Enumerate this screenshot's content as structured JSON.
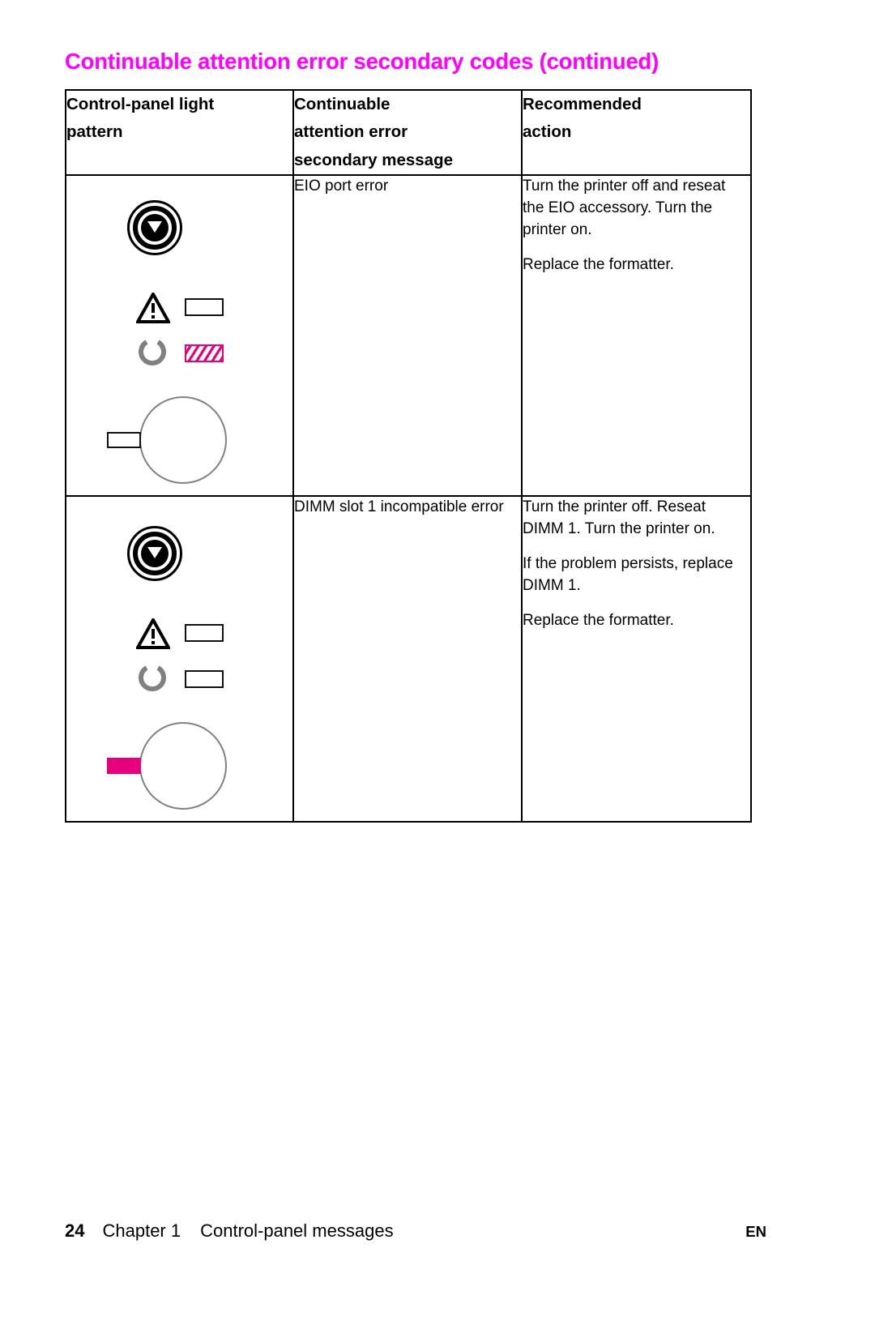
{
  "page": {
    "title": "Continuable attention error secondary codes (continued)",
    "title_color": "#ff00ff",
    "accent_color": "#e5007d"
  },
  "table": {
    "headers": [
      {
        "line1": "Control-panel light",
        "line2": "pattern",
        "line3": ""
      },
      {
        "line1": "Continuable",
        "line2": "attention error",
        "line3": "secondary message"
      },
      {
        "line1": "Recommended",
        "line2": "action",
        "line3": ""
      }
    ],
    "rows": [
      {
        "light_pattern": {
          "go_button": "go-button-icon",
          "attention_icon": "warning-triangle-icon",
          "attention_led": "off",
          "ready_icon": "ready-c-icon",
          "ready_led": "blinking",
          "knob_tab": "outline"
        },
        "message": "EIO port error",
        "action_paragraphs": [
          "Turn the printer off and reseat the EIO accessory. Turn the printer on.",
          "Replace the formatter."
        ]
      },
      {
        "light_pattern": {
          "go_button": "go-button-icon",
          "attention_icon": "warning-triangle-icon",
          "attention_led": "off",
          "ready_icon": "ready-c-icon",
          "ready_led": "off",
          "knob_tab": "solid"
        },
        "message": "DIMM slot 1 incompatible error",
        "action_paragraphs": [
          "Turn the printer off. Reseat DIMM 1. Turn the printer on.",
          "If the problem persists, replace DIMM 1.",
          "Replace the formatter."
        ]
      }
    ]
  },
  "footer": {
    "page_number": "24",
    "chapter": "Chapter 1",
    "section": "Control-panel messages",
    "language": "EN"
  }
}
